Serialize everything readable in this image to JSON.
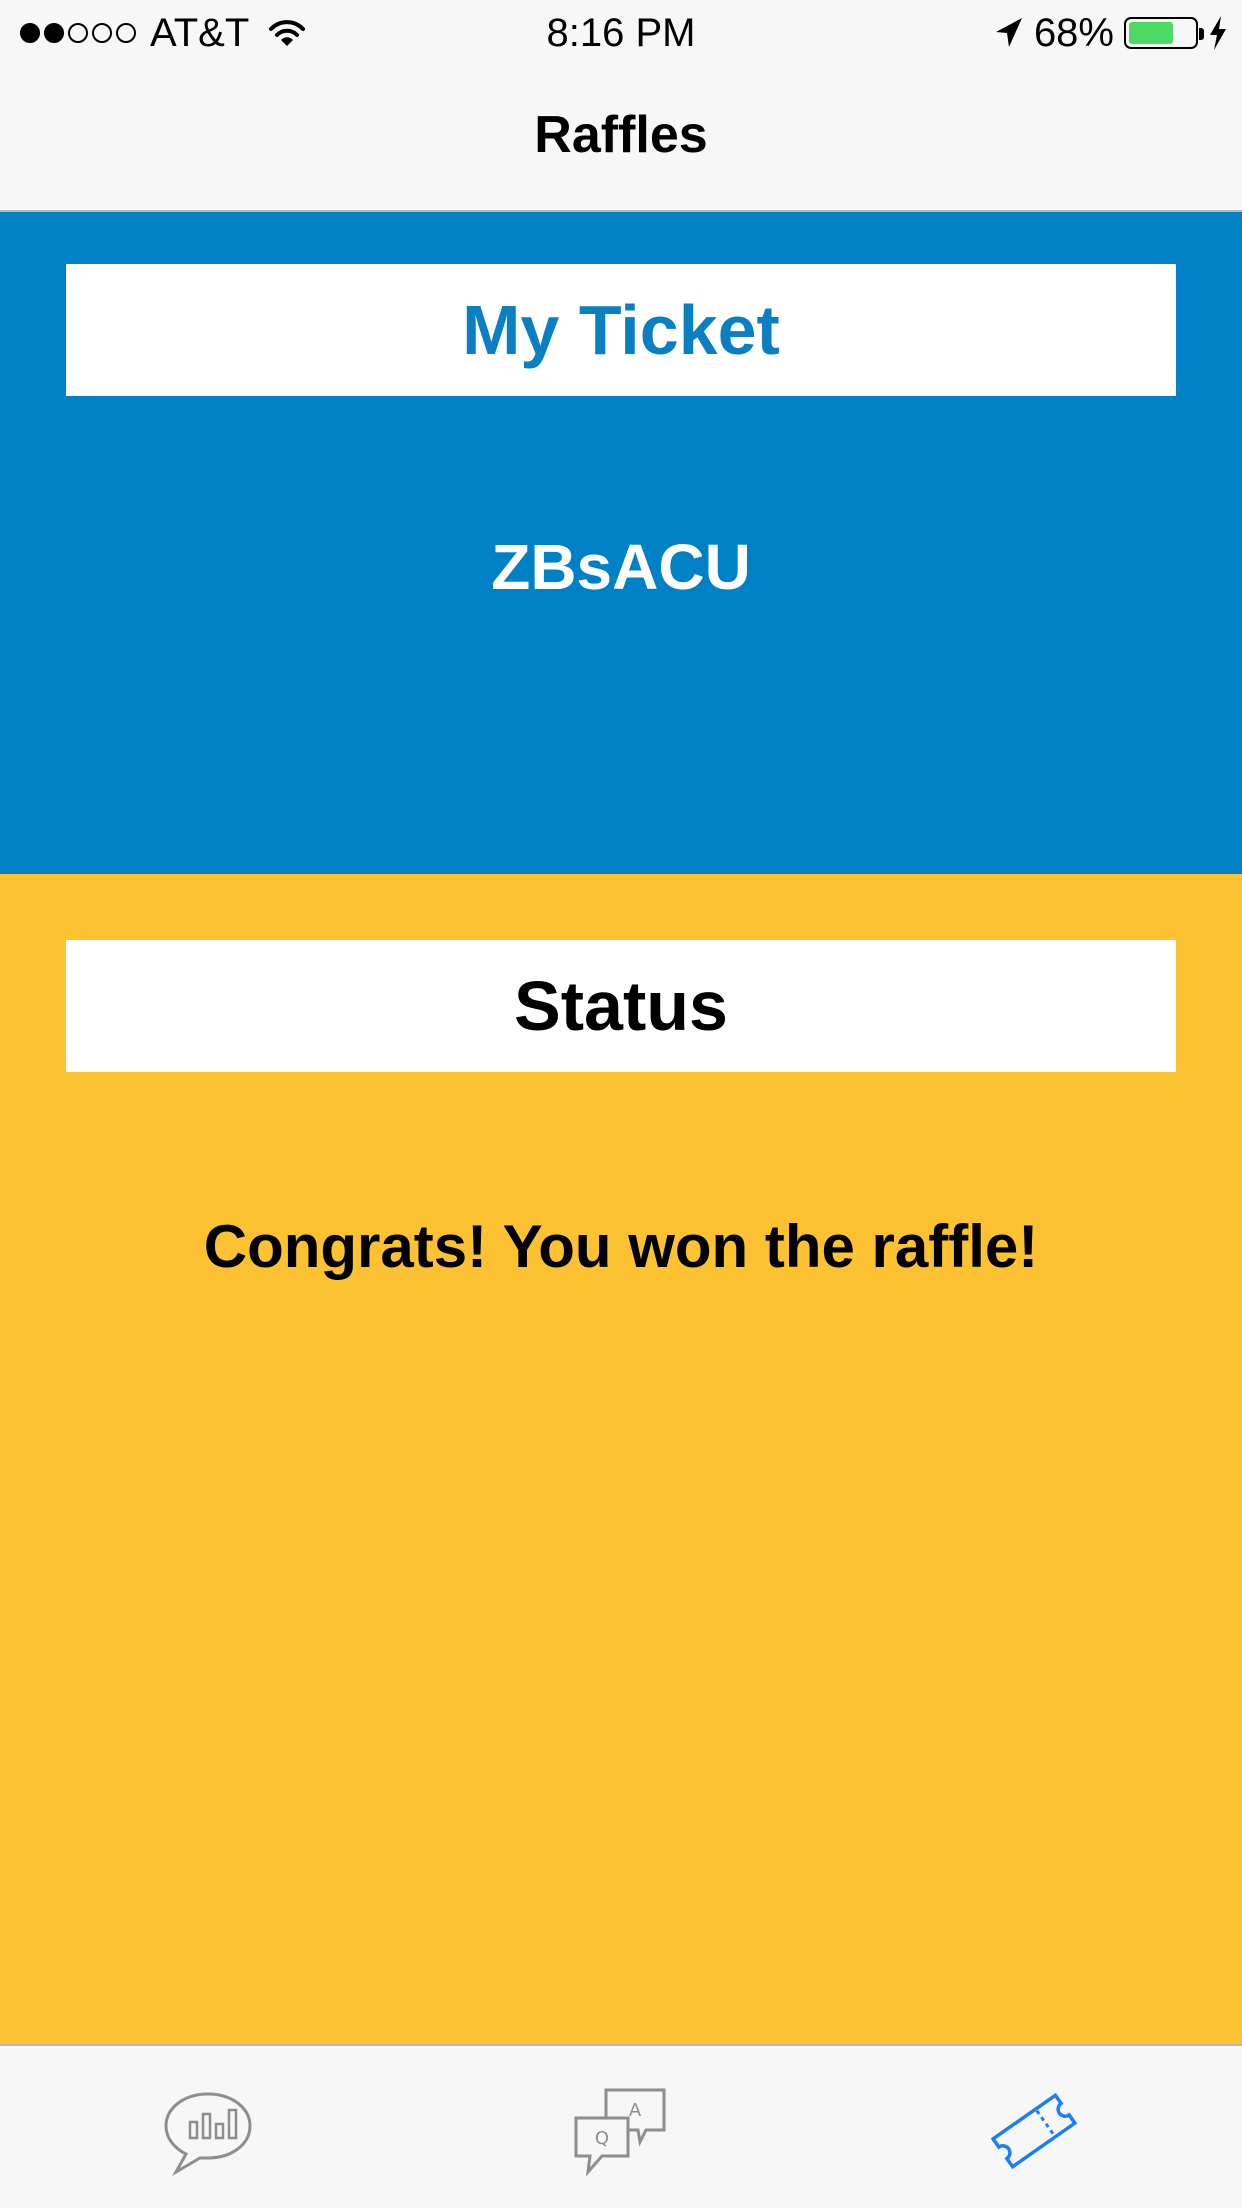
{
  "status_bar": {
    "carrier": "AT&T",
    "time": "8:16 PM",
    "battery_percent": "68%",
    "battery_level": 0.68,
    "signal_bars": 2
  },
  "nav": {
    "title": "Raffles"
  },
  "ticket": {
    "header": "My Ticket",
    "code": "ZBsACU",
    "color": "#0080c5"
  },
  "status": {
    "header": "Status",
    "message": "Congrats! You won the raffle!",
    "color": "#fdc232"
  },
  "tab_bar": {
    "tabs": [
      {
        "icon": "stats-speech-bubble-icon",
        "active": false
      },
      {
        "icon": "qa-bubbles-icon",
        "active": false
      },
      {
        "icon": "raffle-ticket-icon",
        "active": true
      }
    ],
    "active_color": "#1a7ff5",
    "inactive_color": "#8e8e8e"
  }
}
